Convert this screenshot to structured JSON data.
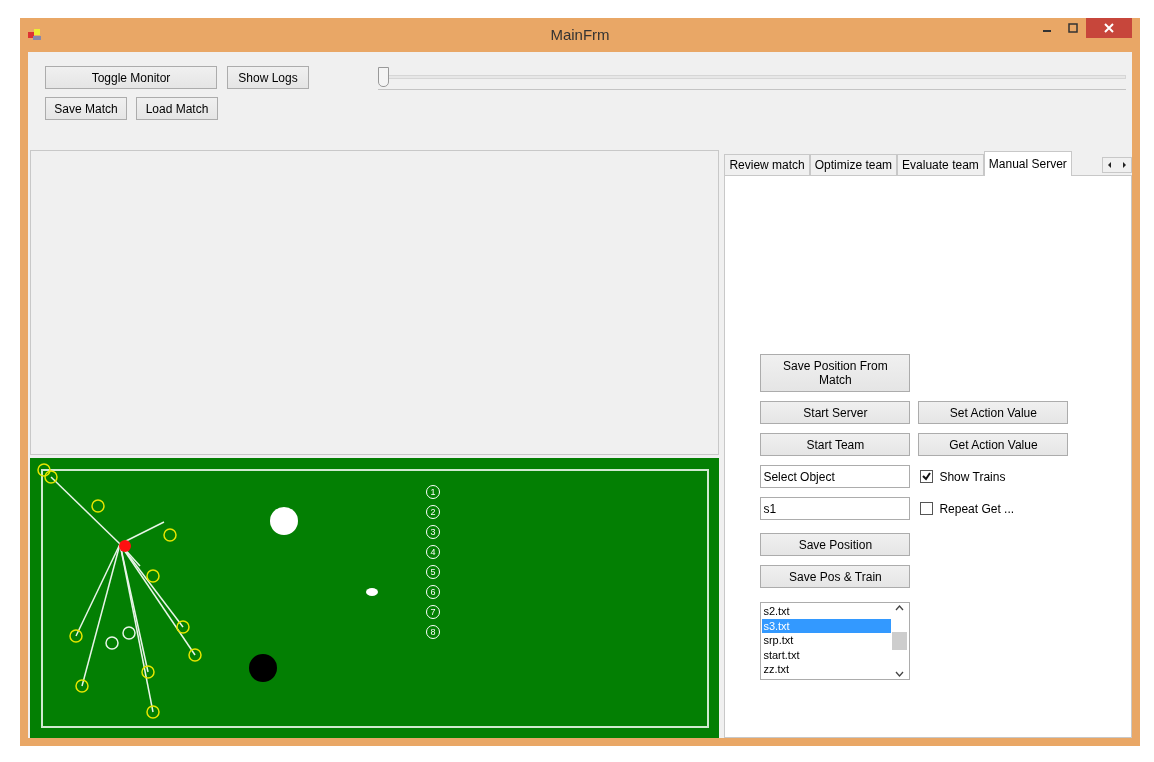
{
  "window": {
    "title": "MainFrm"
  },
  "toolbar": {
    "buttons": [
      "Toggle Monitor",
      "Show Logs",
      "Save Match",
      "Load Match"
    ]
  },
  "slider": {
    "level": 0
  },
  "field": {
    "markers": [
      "1",
      "2",
      "3",
      "4",
      "5",
      "6",
      "7",
      "8"
    ]
  },
  "tabs": [
    {
      "label": "Review match",
      "selected": false
    },
    {
      "label": "Optimize team",
      "selected": false
    },
    {
      "label": "Evaluate team",
      "selected": false
    },
    {
      "label": "Manual Server",
      "selected": true
    }
  ],
  "manual_server": {
    "save_from_match": "Save Position From Match",
    "start_server": "Start Server",
    "set_action": "Set Action Value",
    "start_team": "Start Team",
    "get_action": "Get Action Value",
    "object_field": {
      "value": "Select Object"
    },
    "id_field": {
      "value": "s1"
    },
    "checkboxes": [
      {
        "label": "Show Trains",
        "checked": true
      },
      {
        "label": "Repeat Get ...",
        "checked": false
      }
    ],
    "save_position": "Save Position",
    "save_train": "Save Pos & Train",
    "files": [
      {
        "label": "s2.txt",
        "selected": false
      },
      {
        "label": "s3.txt",
        "selected": true
      },
      {
        "label": "srp.txt",
        "selected": false
      },
      {
        "label": "start.txt",
        "selected": false
      },
      {
        "label": "zz.txt",
        "selected": false
      }
    ]
  }
}
